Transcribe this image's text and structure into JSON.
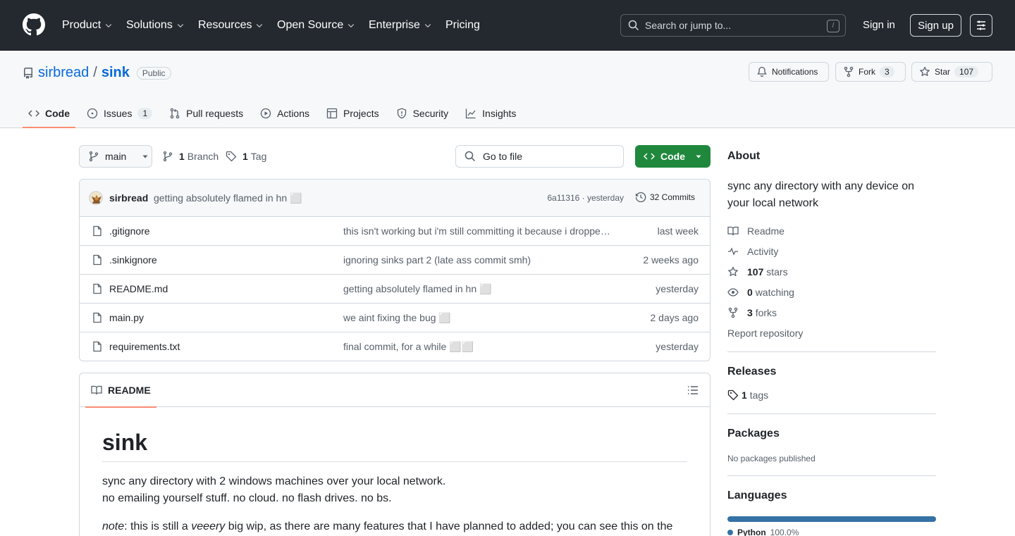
{
  "header": {
    "nav": [
      "Product",
      "Solutions",
      "Resources",
      "Open Source",
      "Enterprise",
      "Pricing"
    ],
    "search_placeholder": "Search or jump to...",
    "search_shortcut": "/",
    "sign_in": "Sign in",
    "sign_up": "Sign up"
  },
  "repo": {
    "owner": "sirbread",
    "separator": "/",
    "name": "sink",
    "visibility": "Public",
    "notifications_label": "Notifications",
    "fork_label": "Fork",
    "fork_count": "3",
    "star_label": "Star",
    "star_count": "107"
  },
  "tabs": [
    {
      "label": "Code",
      "icon": "code-icon",
      "active": true
    },
    {
      "label": "Issues",
      "icon": "issue-icon",
      "count": "1"
    },
    {
      "label": "Pull requests",
      "icon": "pull-request-icon"
    },
    {
      "label": "Actions",
      "icon": "play-icon"
    },
    {
      "label": "Projects",
      "icon": "table-icon"
    },
    {
      "label": "Security",
      "icon": "shield-icon"
    },
    {
      "label": "Insights",
      "icon": "graph-icon"
    }
  ],
  "toolbar": {
    "branch": "main",
    "branch_count": "1",
    "branch_label": "Branch",
    "tag_count": "1",
    "tag_label": "Tag",
    "goto_file": "Go to file",
    "code_button": "Code"
  },
  "latest_commit": {
    "author": "sirbread",
    "message": "getting absolutely flamed in hn ⬜",
    "hash_time": "6a11316 · yesterday",
    "commits": "32 Commits"
  },
  "files": [
    {
      "name": ".gitignore",
      "message": "this isn't working but i'm still committing it because i dropped my ...",
      "time": "last week"
    },
    {
      "name": ".sinkignore",
      "message": "ignoring sinks part 2 (late ass commit smh)",
      "time": "2 weeks ago"
    },
    {
      "name": "README.md",
      "message": "getting absolutely flamed in hn ⬜",
      "time": "yesterday"
    },
    {
      "name": "main.py",
      "message": "we aint fixing the bug ⬜",
      "time": "2 days ago"
    },
    {
      "name": "requirements.txt",
      "message": "final commit, for a while ⬜⬜",
      "time": "yesterday"
    }
  ],
  "readme": {
    "tab_label": "README",
    "title": "sink",
    "line1": "sync any directory with 2 windows machines over your local network.",
    "line2": "no emailing yourself stuff. no cloud. no flash drives. no bs.",
    "note_label": "note",
    "note_rest": ": this is still a ",
    "note_em": "veeery",
    "note_tail": " big wip, as there are many features that I have planned to added; you can see this on the"
  },
  "about": {
    "heading": "About",
    "description": "sync any directory with any device on your local network",
    "readme": "Readme",
    "activity": "Activity",
    "stars_count": "107",
    "stars_label": "stars",
    "watching_count": "0",
    "watching_label": "watching",
    "forks_count": "3",
    "forks_label": "forks",
    "report": "Report repository"
  },
  "releases": {
    "heading": "Releases",
    "tags_count": "1",
    "tags_label": "tags"
  },
  "packages": {
    "heading": "Packages",
    "text": "No packages published"
  },
  "languages": {
    "heading": "Languages",
    "items": [
      {
        "name": "Python",
        "percent": "100.0%",
        "color": "#3572a5"
      }
    ]
  }
}
